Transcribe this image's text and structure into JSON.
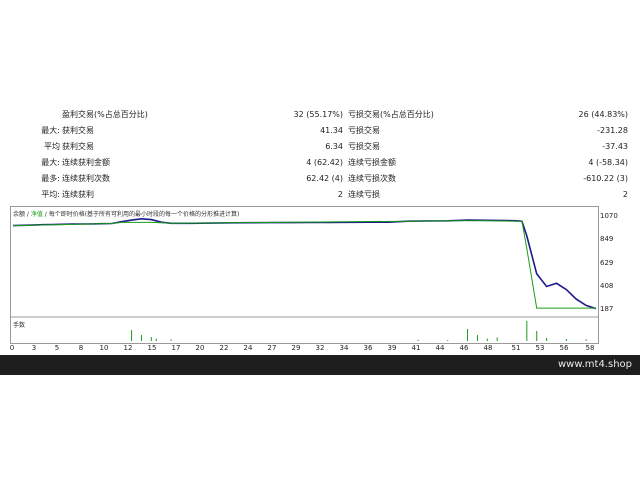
{
  "stats": {
    "rows": [
      {
        "prefix": "",
        "label": "盈利交易(%占总百分比)",
        "value": "32 (55.17%)",
        "label2": "亏损交易(%占总百分比)",
        "value2": "26 (44.83%)"
      },
      {
        "prefix": "最大:",
        "label": "获利交易",
        "value": "41.34",
        "label2": "亏损交易",
        "value2": "-231.28"
      },
      {
        "prefix": "平均",
        "label": "获利交易",
        "value": "6.34",
        "label2": "亏损交易",
        "value2": "-37.43"
      },
      {
        "prefix": "最大:",
        "label": "连续获利金额",
        "value": "4 (62.42)",
        "label2": "连续亏损金额",
        "value2": "4 (-58.34)"
      },
      {
        "prefix": "最多:",
        "label": "连续获利次数",
        "value": "62.42 (4)",
        "label2": "连续亏损次数",
        "value2": "-610.22 (3)"
      },
      {
        "prefix": "平均:",
        "label": "连续获利",
        "value": "2",
        "label2": "连续亏损",
        "value2": "2"
      }
    ]
  },
  "chart": {
    "header_balance": "余额",
    "header_sep": " / ",
    "header_equity": "净值",
    "header_rest": " / 每个即时价格(基于所有可利用的最小时段的每一个价格的分形推进计算)",
    "sub_label": "手数",
    "footer_text": "www.mt4.shop"
  },
  "chart_data": {
    "type": "line",
    "ylim": [
      187,
      1070
    ],
    "yticks": [
      "1070",
      "849",
      "629",
      "408",
      "187"
    ],
    "xticks": [
      "0",
      "3",
      "5",
      "8",
      "10",
      "12",
      "15",
      "17",
      "20",
      "22",
      "24",
      "27",
      "29",
      "32",
      "34",
      "36",
      "39",
      "41",
      "44",
      "46",
      "48",
      "51",
      "53",
      "56",
      "58"
    ],
    "series": [
      {
        "color": "#1a1a8c",
        "x": [
          0,
          1,
          2,
          3,
          4,
          5,
          6,
          7,
          8,
          9,
          10,
          11,
          12,
          13,
          14,
          15,
          16,
          17,
          18,
          20,
          22,
          24,
          26,
          28,
          30,
          32,
          34,
          36,
          38,
          40,
          42,
          44,
          46,
          48,
          50,
          51,
          51.5,
          52,
          53,
          54,
          55,
          56,
          57,
          58,
          59
        ],
        "y": [
          998,
          1001,
          1003,
          1006,
          1008,
          1010,
          1012,
          1013,
          1014,
          1016,
          1018,
          1035,
          1050,
          1062,
          1055,
          1030,
          1020,
          1020,
          1020,
          1022,
          1024,
          1025,
          1026,
          1026,
          1027,
          1028,
          1029,
          1030,
          1030,
          1040,
          1042,
          1043,
          1050,
          1048,
          1046,
          1043,
          1040,
          900,
          540,
          420,
          450,
          390,
          300,
          240,
          210
        ]
      },
      {
        "color": "#1a9d1a",
        "x": [
          0,
          10,
          11,
          12,
          13,
          14,
          15,
          16,
          40,
          44,
          46,
          48,
          51,
          51.5,
          52,
          53,
          54,
          55,
          56,
          57,
          58,
          59
        ],
        "y": [
          998,
          1018,
          1028,
          1028,
          1028,
          1028,
          1025,
          1020,
          1040,
          1043,
          1043,
          1043,
          1040,
          1040,
          780,
          215,
          215,
          215,
          215,
          215,
          215,
          215
        ]
      }
    ],
    "lots_bars": [
      {
        "x": 12,
        "v": 0.55
      },
      {
        "x": 13,
        "v": 0.3
      },
      {
        "x": 14,
        "v": 0.2
      },
      {
        "x": 14.5,
        "v": 0.12
      },
      {
        "x": 16,
        "v": 0.08
      },
      {
        "x": 41,
        "v": 0.06
      },
      {
        "x": 44,
        "v": 0.05
      },
      {
        "x": 46,
        "v": 0.6
      },
      {
        "x": 47,
        "v": 0.3
      },
      {
        "x": 48,
        "v": 0.12
      },
      {
        "x": 49,
        "v": 0.18
      },
      {
        "x": 52,
        "v": 1.0
      },
      {
        "x": 53,
        "v": 0.5
      },
      {
        "x": 54,
        "v": 0.15
      },
      {
        "x": 56,
        "v": 0.1
      },
      {
        "x": 58,
        "v": 0.08
      }
    ]
  }
}
